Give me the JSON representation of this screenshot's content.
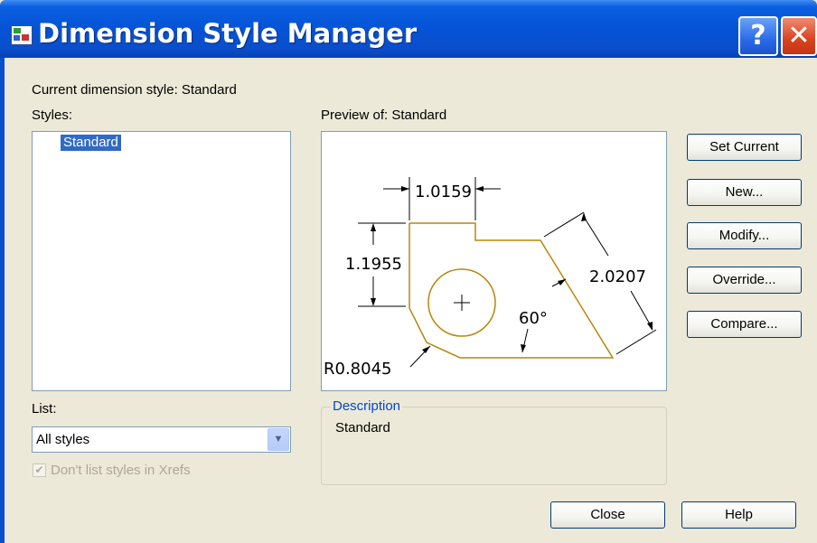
{
  "window": {
    "title": "Dimension Style Manager",
    "help_glyph": "?",
    "close_glyph": "✕"
  },
  "current_style": {
    "label": "Current dimension style: Standard"
  },
  "styles": {
    "label": "Styles:",
    "items": [
      "Standard"
    ],
    "selected": "Standard"
  },
  "list_filter": {
    "label": "List:",
    "selected": "All styles",
    "arrow_glyph": "▼"
  },
  "xref_checkbox": {
    "label": "Don't list styles in Xrefs",
    "checked": true,
    "check_glyph": "✔",
    "enabled": false
  },
  "preview": {
    "label": "Preview of: Standard",
    "dims": {
      "horizontal": "1.0159",
      "vertical": "1.1955",
      "aligned": "2.0207",
      "angle": "60°",
      "radius": "R0.8045"
    },
    "geometry_color": "#b8860b",
    "dimension_color": "#000000"
  },
  "description": {
    "title": "Description",
    "text": "Standard"
  },
  "buttons": {
    "set_current": "Set Current",
    "new": "New...",
    "modify": "Modify...",
    "override": "Override...",
    "compare": "Compare...",
    "close": "Close",
    "help": "Help"
  },
  "colors": {
    "titlebar": "#0553d6",
    "dialog_bg": "#ece9d8",
    "selection": "#316ac5",
    "group_title": "#0046d5"
  }
}
